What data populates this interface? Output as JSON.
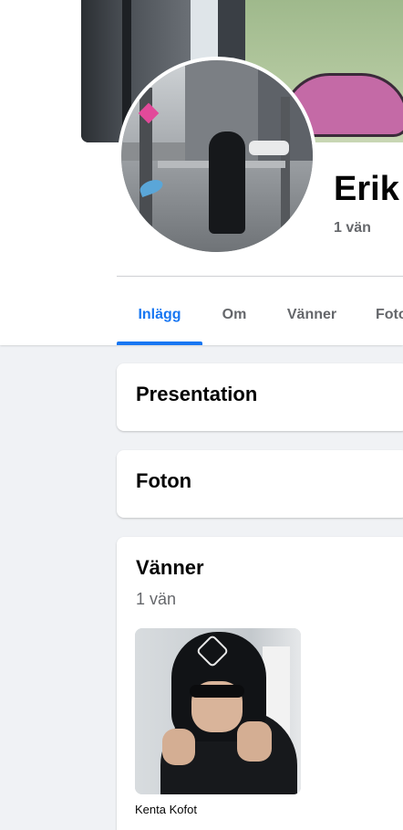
{
  "profile": {
    "name": "Erik",
    "friend_count_label": "1 vän"
  },
  "tabs": [
    {
      "label": "Inlägg",
      "active": true
    },
    {
      "label": "Om",
      "active": false
    },
    {
      "label": "Vänner",
      "active": false
    },
    {
      "label": "Foto",
      "active": false
    }
  ],
  "cards": {
    "presentation_title": "Presentation",
    "photos_title": "Foton",
    "friends_title": "Vänner",
    "friends_count_label": "1 vän"
  },
  "friends": [
    {
      "name": "Kenta Kofot"
    }
  ],
  "colors": {
    "accent": "#1877f2",
    "page_bg": "#f0f2f5",
    "secondary_text": "#65676b"
  }
}
